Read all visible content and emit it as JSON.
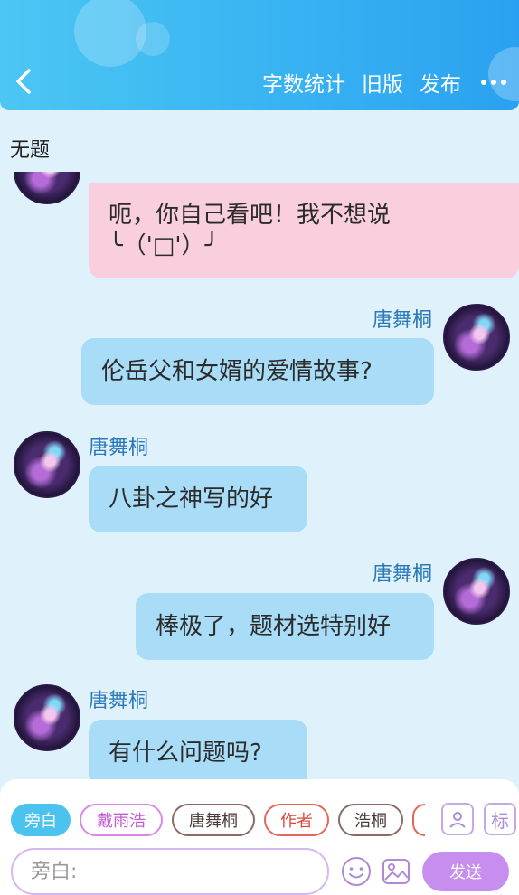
{
  "header": {
    "back_icon": "chevron-left-icon",
    "actions": [
      "字数统计",
      "旧版",
      "发布"
    ],
    "more_icon": "more-dots-icon"
  },
  "document": {
    "title": "无题"
  },
  "messages": [
    {
      "side": "left",
      "sender": "",
      "lines": [
        "呃，你自己看吧！我不想说",
        "╰（'□'）╯"
      ],
      "bubble_color": "#f9cfde"
    },
    {
      "side": "right",
      "sender": "唐舞桐",
      "text": "伦岳父和女婿的爱情故事?",
      "bubble_color": "#a9dcf6"
    },
    {
      "side": "left",
      "sender": "唐舞桐",
      "text": "八卦之神写的好",
      "bubble_color": "#a9dcf6"
    },
    {
      "side": "right",
      "sender": "唐舞桐",
      "text": "棒极了，题材选特别好",
      "bubble_color": "#a9dcf6"
    },
    {
      "side": "left",
      "sender": "唐舞桐",
      "text": "有什么问题吗?",
      "bubble_color": "#a9dcf6"
    }
  ],
  "composer": {
    "roles": [
      "旁白",
      "戴雨浩",
      "唐舞桐",
      "作者",
      "浩桐"
    ],
    "active_role": "旁白",
    "tools": [
      {
        "icon": "person-card-icon"
      },
      {
        "icon": "tag-icon",
        "label": "标"
      }
    ],
    "input": {
      "placeholder": "旁白:",
      "value": ""
    },
    "emoji_icon": "smiley-icon",
    "image_icon": "image-icon",
    "send_label": "发送"
  },
  "colors": {
    "header_start": "#4cc6f3",
    "header_end": "#2aa1f0",
    "background": "#dff2fb",
    "bubble_blue": "#a9dcf6",
    "bubble_pink": "#f9cfde",
    "name_color": "#2b79b9",
    "send_button": "#c78ef0"
  }
}
